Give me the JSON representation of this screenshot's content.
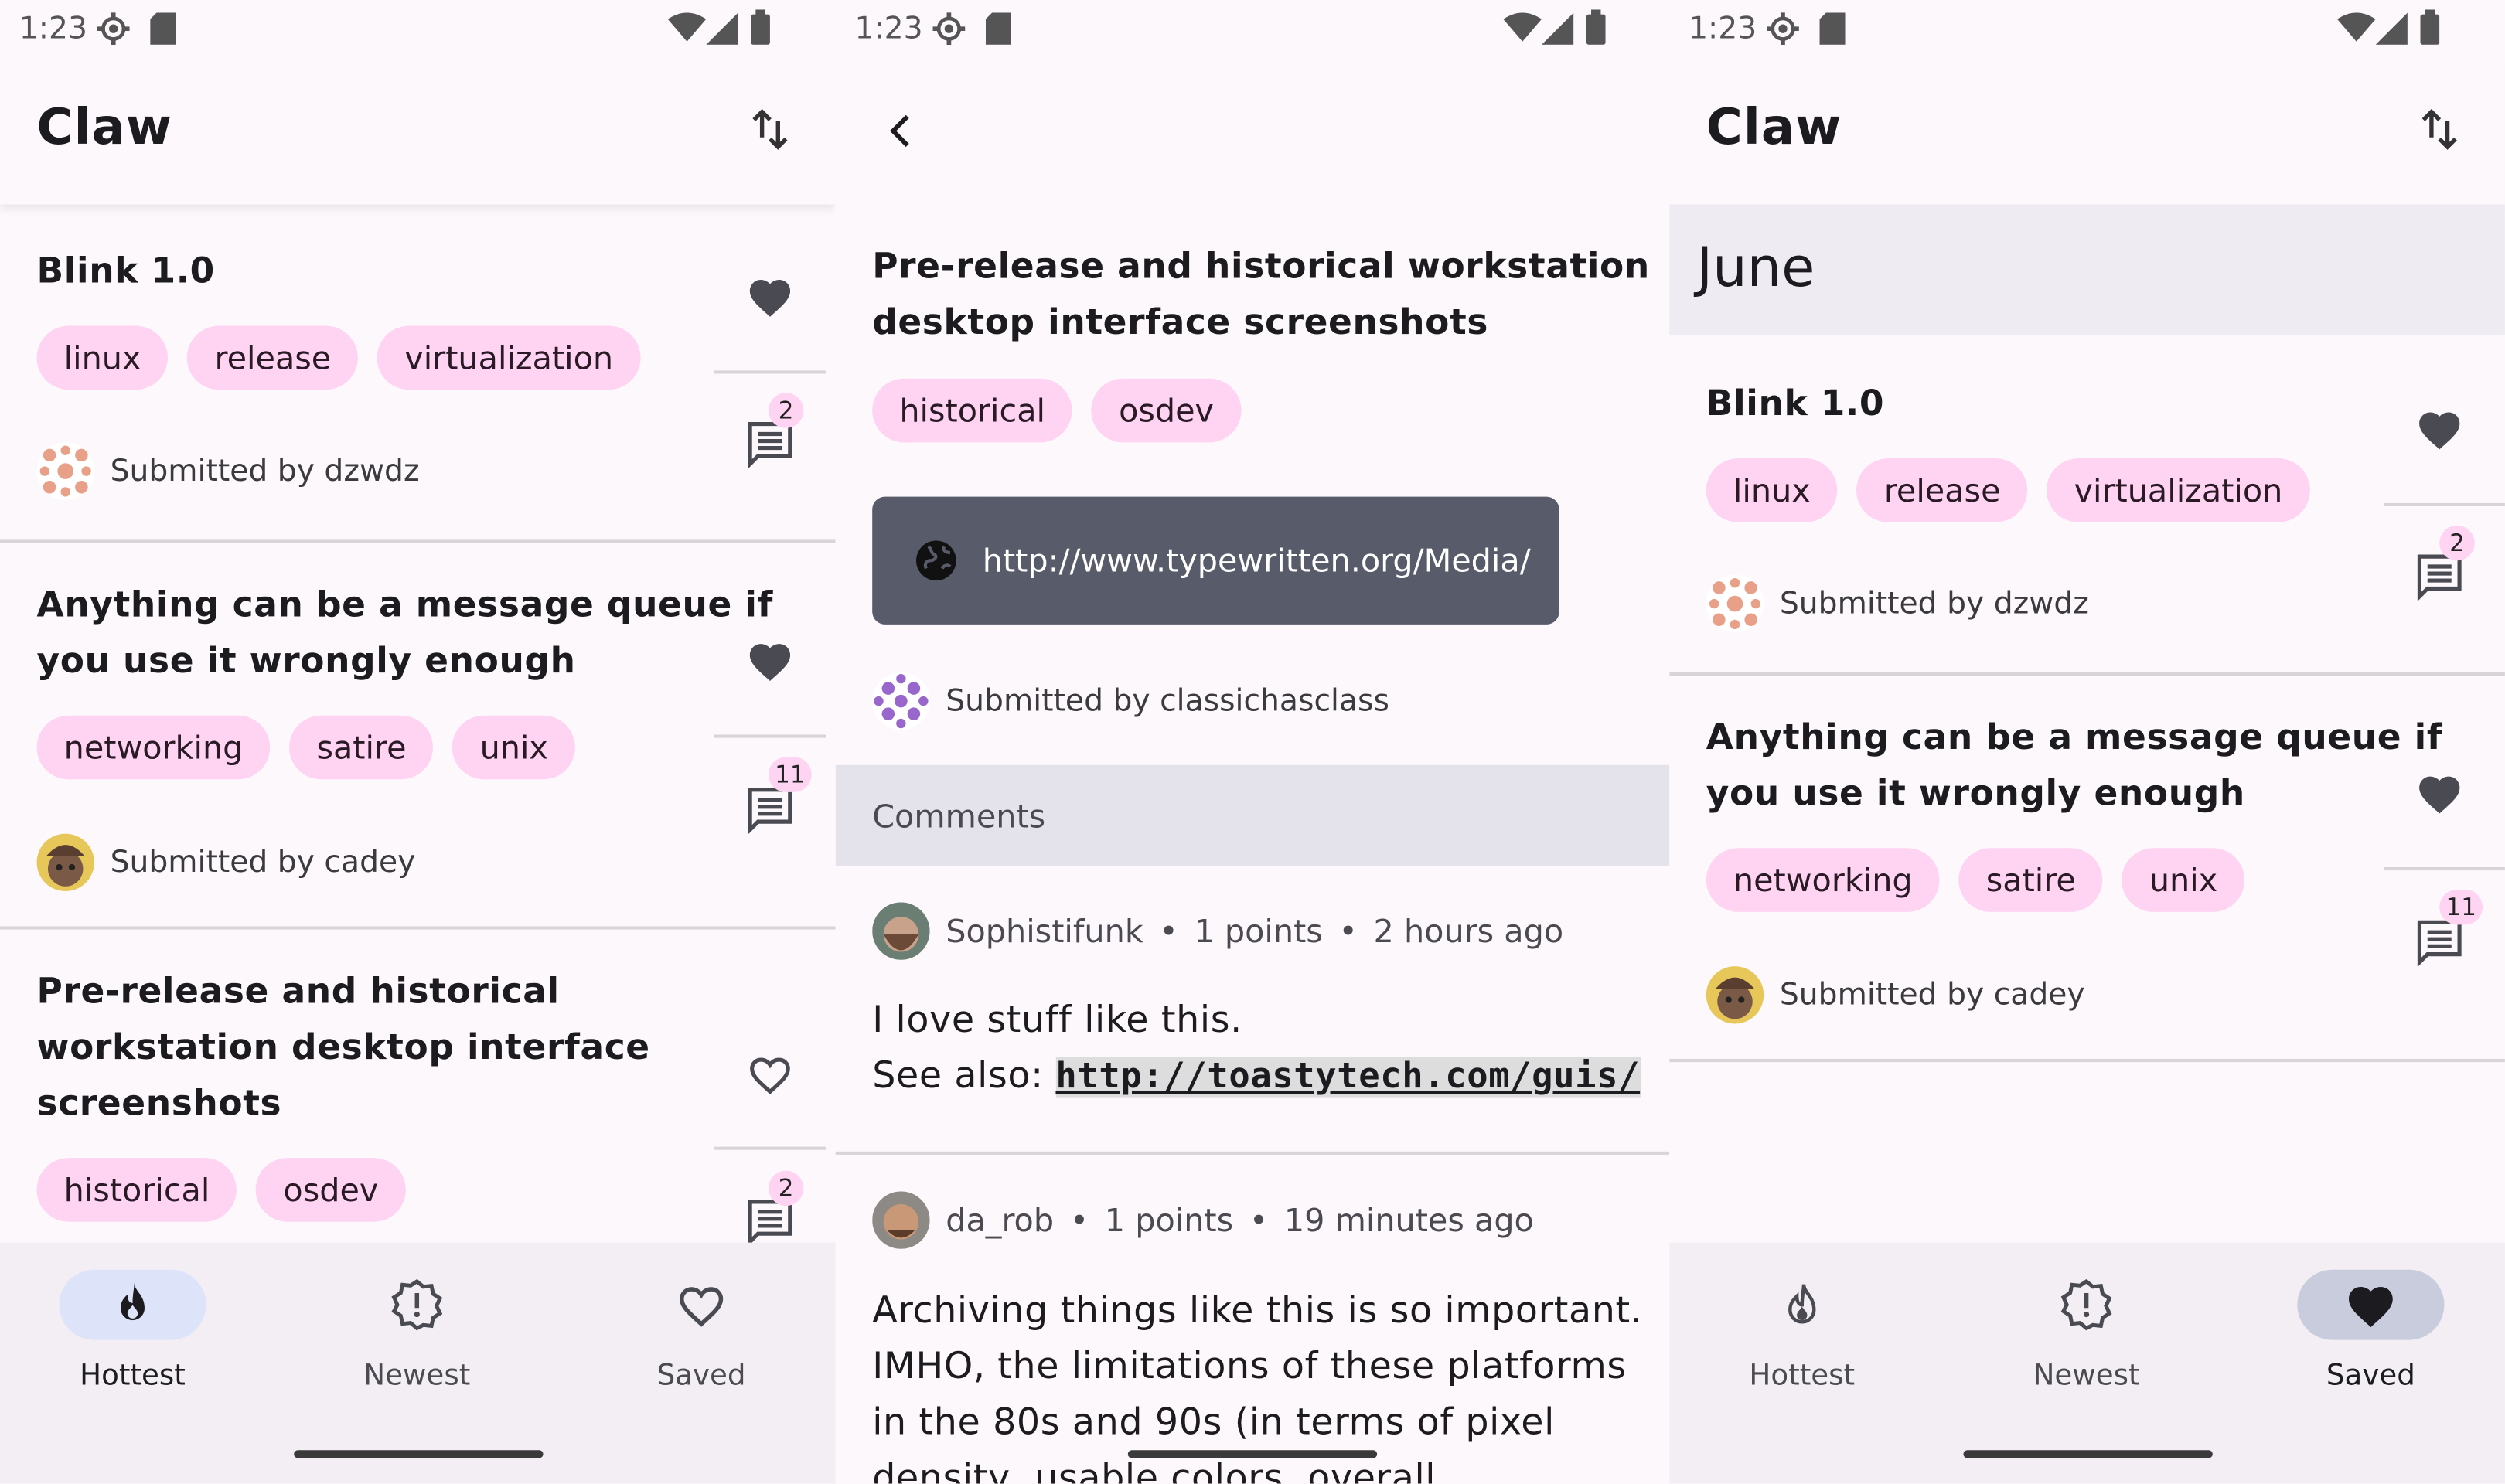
{
  "status": {
    "time": "1:23"
  },
  "app": {
    "title": "Claw"
  },
  "posts": [
    {
      "title_lines": [
        "Blink 1.0"
      ],
      "tags": [
        "linux",
        "release",
        "virtualization"
      ],
      "byline": "Submitted by dzwdz",
      "comments": "2",
      "saved": true
    },
    {
      "title_lines": [
        "Anything can be a message queue if",
        "you use it wrongly enough"
      ],
      "tags": [
        "networking",
        "satire",
        "unix"
      ],
      "byline": "Submitted by cadey",
      "comments": "11",
      "saved": true
    },
    {
      "title_lines": [
        "Pre-release and historical",
        "workstation desktop interface",
        "screenshots"
      ],
      "tags": [
        "historical",
        "osdev"
      ],
      "byline": "",
      "comments": "2",
      "saved": false
    }
  ],
  "detail": {
    "title_lines": [
      "Pre-release and historical workstation",
      "desktop interface screenshots"
    ],
    "tags": [
      "historical",
      "osdev"
    ],
    "url": "http://www.typewritten.org/Media/",
    "byline": "Submitted by classichasclass",
    "comments_header": "Comments",
    "comments": [
      {
        "author": "Sophistifunk",
        "points": "1 points",
        "time": "2 hours ago",
        "line1": "I love stuff like this.",
        "line2_prefix": "See also: ",
        "line2_link": "http://toastytech.com/guis/"
      },
      {
        "author": "da_rob",
        "points": "1 points",
        "time": "19 minutes ago",
        "lines": [
          "Archiving things like this is so important.",
          "IMHO, the limitations of these platforms",
          "in the 80s and 90s (in terms of pixel",
          "density, usable colors, overall"
        ]
      }
    ]
  },
  "saved_view": {
    "month": "June"
  },
  "nav": {
    "hottest": "Hottest",
    "newest": "Newest",
    "saved": "Saved"
  },
  "colors": {
    "chip": "#ffd4f2",
    "nav_active": "#dde3f8",
    "nav_active_saved": "#c9ccdc",
    "link_box": "#575b6a"
  }
}
